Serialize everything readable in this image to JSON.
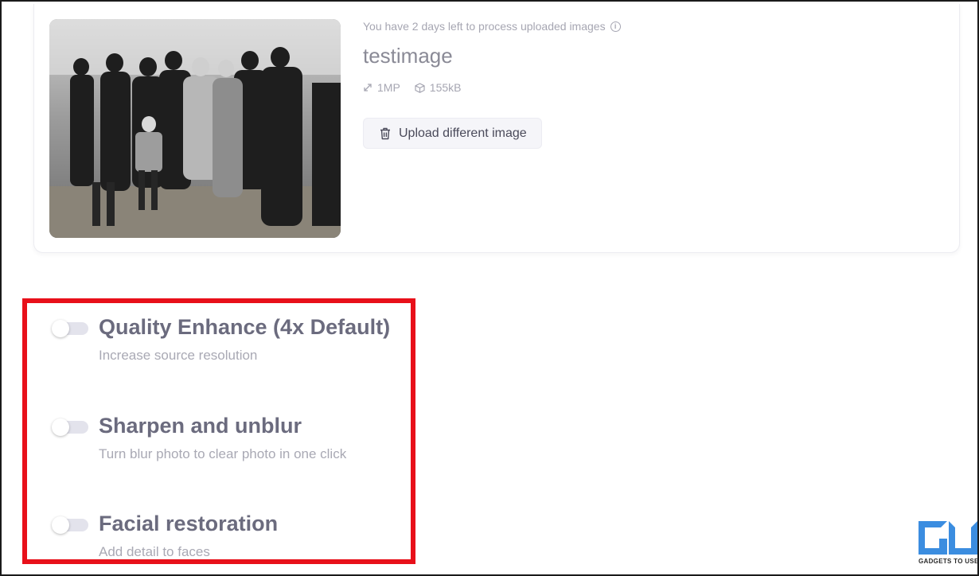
{
  "upload": {
    "notice": "You have 2 days left to process uploaded images",
    "notice_icon": "info-icon",
    "filename": "testimage",
    "resolution": "1MP",
    "resolution_icon": "resize-icon",
    "filesize": "155kB",
    "filesize_icon": "box-icon",
    "upload_button_label": "Upload different image",
    "upload_button_icon": "trash-icon"
  },
  "options": [
    {
      "title": "Quality Enhance (4x Default)",
      "description": "Increase source resolution",
      "enabled": false
    },
    {
      "title": "Sharpen and unblur",
      "description": "Turn blur photo to clear photo in one click",
      "enabled": false
    },
    {
      "title": "Facial restoration",
      "description": "Add detail to faces",
      "enabled": false
    }
  ],
  "watermark": {
    "text": "GADGETS TO USE"
  },
  "colors": {
    "highlight_border": "#e8101a",
    "option_title": "#6b6b7e",
    "option_desc": "#a9a9b4",
    "watermark_blue": "#3b8de0"
  }
}
